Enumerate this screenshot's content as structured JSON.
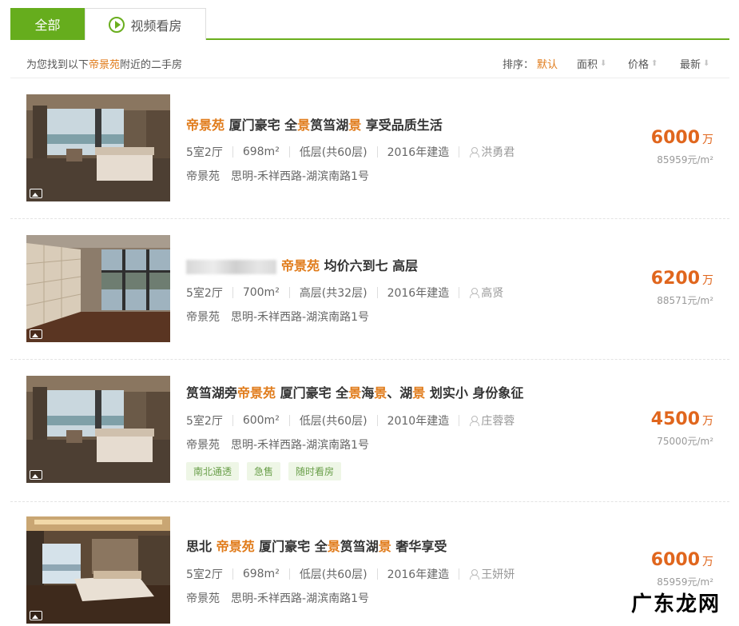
{
  "tabs": {
    "all": "全部",
    "video": "视频看房"
  },
  "search": {
    "prefix": "为您找到以下",
    "keyword": "帝景苑",
    "suffix": "附近的二手房"
  },
  "sort": {
    "label": "排序：",
    "default": "默认",
    "area": "面积",
    "price": "价格",
    "newest": "最新"
  },
  "listings": [
    {
      "title_parts": [
        [
          "帝景苑",
          true
        ],
        [
          " 厦门豪宅 全",
          false
        ],
        [
          "景",
          true
        ],
        [
          "筼筜湖",
          false
        ],
        [
          "景",
          true
        ],
        [
          " 享受品质生活",
          false
        ]
      ],
      "layout": "5室2厅",
      "area": "698m²",
      "floor": "低层(共60层)",
      "built": "2016年建造",
      "agent": "洪勇君",
      "community": "帝景苑",
      "address": "思明-禾祥西路-湖滨南路1号",
      "price": "6000",
      "price_unit": "万",
      "unit_price": "85959元/m²",
      "tags": []
    },
    {
      "title_parts": [
        [
          "帝景苑",
          true
        ],
        [
          " 均价六到七 高层",
          false
        ]
      ],
      "layout": "5室2厅",
      "area": "700m²",
      "floor": "高层(共32层)",
      "built": "2016年建造",
      "agent": "高贤",
      "community": "帝景苑",
      "address": "思明-禾祥西路-湖滨南路1号",
      "price": "6200",
      "price_unit": "万",
      "unit_price": "88571元/m²",
      "tags": []
    },
    {
      "title_parts": [
        [
          "筼筜湖旁",
          false
        ],
        [
          "帝景苑",
          true
        ],
        [
          " 厦门豪宅 全",
          false
        ],
        [
          "景",
          true
        ],
        [
          "海",
          false
        ],
        [
          "景",
          true
        ],
        [
          "、湖",
          false
        ],
        [
          "景",
          true
        ],
        [
          " 划实小 身份象征",
          false
        ]
      ],
      "layout": "5室2厅",
      "area": "600m²",
      "floor": "低层(共60层)",
      "built": "2010年建造",
      "agent": "庄蓉蓉",
      "community": "帝景苑",
      "address": "思明-禾祥西路-湖滨南路1号",
      "price": "4500",
      "price_unit": "万",
      "unit_price": "75000元/m²",
      "tags": [
        "南北通透",
        "急售",
        "随时看房"
      ]
    },
    {
      "title_parts": [
        [
          "思北 ",
          false
        ],
        [
          "帝景苑",
          true
        ],
        [
          " 厦门豪宅 全",
          false
        ],
        [
          "景",
          true
        ],
        [
          "筼筜湖",
          false
        ],
        [
          "景",
          true
        ],
        [
          " 奢华享受",
          false
        ]
      ],
      "layout": "5室2厅",
      "area": "698m²",
      "floor": "低层(共60层)",
      "built": "2016年建造",
      "agent": "王妍妍",
      "community": "帝景苑",
      "address": "思明-禾祥西路-湖滨南路1号",
      "price": "6000",
      "price_unit": "万",
      "unit_price": "85959元/m²",
      "tags": []
    }
  ],
  "watermark": "广东龙网",
  "colors": {
    "accent_green": "#66ad1d",
    "highlight_orange": "#e07b1a",
    "price_orange": "#e0661d"
  }
}
